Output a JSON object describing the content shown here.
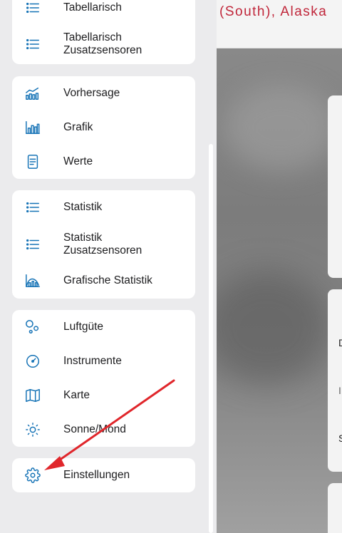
{
  "header": {
    "location": "(South), Alaska"
  },
  "sidebar": {
    "group1": {
      "items": [
        {
          "label": "Tabellarisch",
          "icon": "list-icon"
        },
        {
          "label": "Tabellarisch\nZusatzsensoren",
          "icon": "list-icon"
        }
      ]
    },
    "group2": {
      "items": [
        {
          "label": "Vorhersage",
          "icon": "forecast-chart-icon"
        },
        {
          "label": "Grafik",
          "icon": "bar-chart-icon"
        },
        {
          "label": "Werte",
          "icon": "document-icon"
        }
      ]
    },
    "group3": {
      "items": [
        {
          "label": "Statistik",
          "icon": "list-icon"
        },
        {
          "label": "Statistik\nZusatzsensoren",
          "icon": "list-icon"
        },
        {
          "label": "Grafische Statistik",
          "icon": "graph-statistics-icon"
        }
      ]
    },
    "group4": {
      "items": [
        {
          "label": "Luftgüte",
          "icon": "air-quality-icon"
        },
        {
          "label": "Instrumente",
          "icon": "gauge-icon"
        },
        {
          "label": "Karte",
          "icon": "map-icon"
        },
        {
          "label": "Sonne/Mond",
          "icon": "sun-icon"
        }
      ]
    },
    "group5": {
      "items": [
        {
          "label": "Einstellungen",
          "icon": "gear-icon"
        }
      ]
    }
  },
  "main": {
    "card_letters": [
      "D",
      "I",
      "S"
    ]
  },
  "colors": {
    "accent": "#1673b6",
    "location_text": "#c0263a",
    "annotation_arrow": "#e0262b"
  }
}
